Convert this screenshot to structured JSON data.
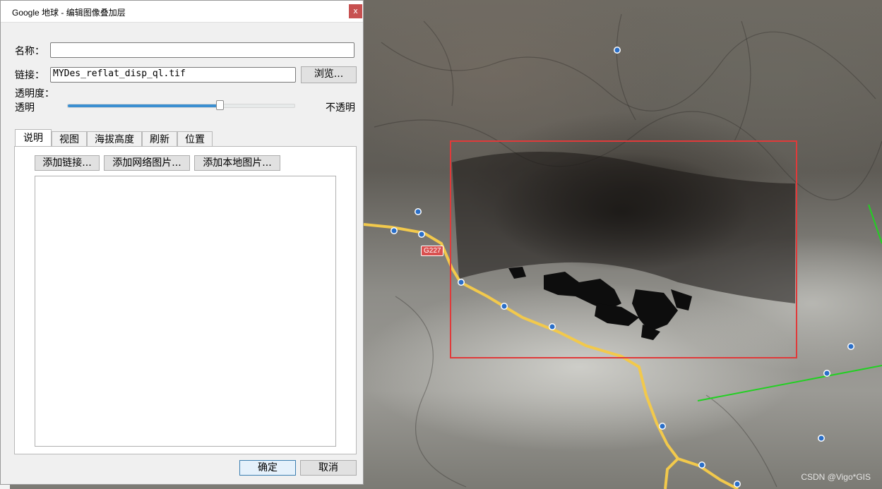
{
  "dialog": {
    "title": "Google 地球 - 编辑图像叠加层",
    "close_glyph": "x",
    "name_label": "名称：",
    "name_value": "",
    "link_label": "链接：",
    "link_value": "MYDes_reflat_disp_ql.tif",
    "browse_label": "浏览...",
    "opacity_label": "透明度：",
    "opacity_min_label": "透明",
    "opacity_max_label": "不透明",
    "opacity_value": 0.67,
    "tabs": [
      {
        "label": "说明",
        "active": true
      },
      {
        "label": "视图",
        "active": false
      },
      {
        "label": "海拔高度",
        "active": false
      },
      {
        "label": "刷新",
        "active": false
      },
      {
        "label": "位置",
        "active": false
      }
    ],
    "add_link_label": "添加链接...",
    "add_web_image_label": "添加网络图片...",
    "add_local_image_label": "添加本地图片...",
    "description_value": "",
    "ok_label": "确定",
    "cancel_label": "取消"
  },
  "map": {
    "road_label": "G227",
    "watermark": "CSDN @Vigo*GIS",
    "selection_color": "#e03a3a",
    "road_color": "#f2c94c",
    "line_color": "#22d022"
  }
}
